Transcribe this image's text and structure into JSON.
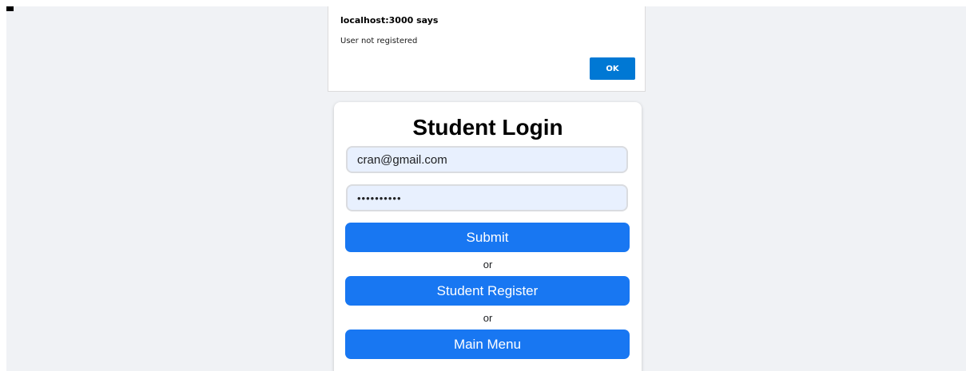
{
  "alert": {
    "title": "localhost:3000 says",
    "message": "User not registered",
    "ok_label": "OK"
  },
  "login": {
    "title": "Student Login",
    "email_value": "cran@gmail.com",
    "password_value": "••••••••••",
    "submit_label": "Submit",
    "or_1": "or",
    "register_label": "Student Register",
    "or_2": "or",
    "menu_label": "Main Menu"
  },
  "colors": {
    "background": "#f0f2f5",
    "button": "#1877f2",
    "input_fill": "#e8f0fe",
    "alert_button": "#0078d4"
  }
}
